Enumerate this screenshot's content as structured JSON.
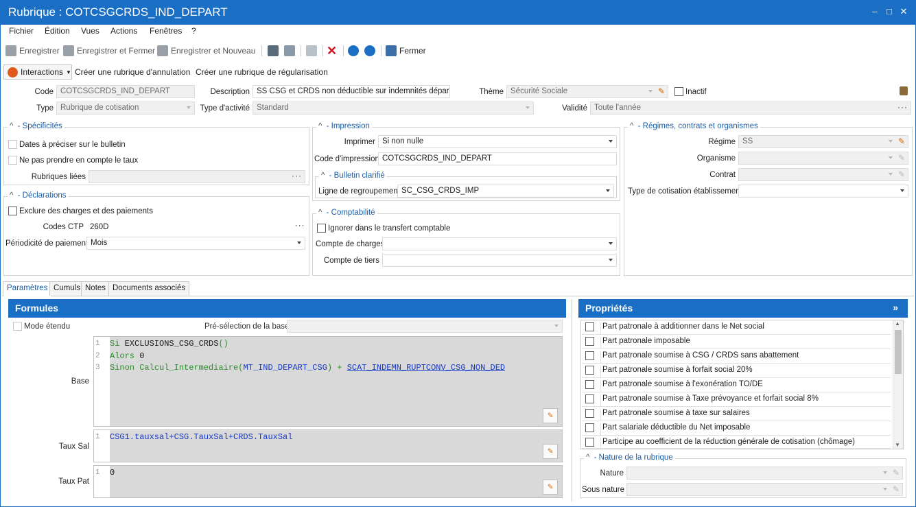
{
  "window": {
    "title": "Rubrique : COTCSGCRDS_IND_DEPART",
    "minimize": "–",
    "maximize": "□",
    "close": "✕"
  },
  "menu": [
    "Fichier",
    "Édition",
    "Vues",
    "Actions",
    "Fenêtres",
    "?"
  ],
  "toolbar": {
    "save": "Enregistrer",
    "save_close": "Enregistrer et Fermer",
    "save_new": "Enregistrer et Nouveau",
    "close": "Fermer"
  },
  "actions": {
    "interactions": "Interactions",
    "cancel_rubrique": "Créer une rubrique d'annulation",
    "regul_rubrique": "Créer une rubrique de régularisation"
  },
  "header": {
    "code_label": "Code",
    "code": "COTCSGCRDS_IND_DEPART",
    "description_label": "Description",
    "description": "SS CSG et CRDS non déductible sur indemnités départ",
    "theme_label": "Thème",
    "theme": "Sécurité Sociale",
    "inactive_label": "Inactif",
    "type_label": "Type",
    "type": "Rubrique de cotisation",
    "activity_label": "Type d'activité",
    "activity": "Standard",
    "validity_label": "Validité",
    "validity": "Toute l'année"
  },
  "specificites": {
    "title": "Spécificités",
    "dates": "Dates à préciser sur le bulletin",
    "taux": "Ne pas prendre en compte le taux",
    "liees_label": "Rubriques liées",
    "liees": ""
  },
  "declarations": {
    "title": "Déclarations",
    "exclure": "Exclure des charges et des paiements",
    "ctp_label": "Codes CTP",
    "ctp": "260D",
    "periodicite_label": "Périodicité de paiement",
    "periodicite": "Mois"
  },
  "impression": {
    "title": "Impression",
    "imprimer_label": "Imprimer",
    "imprimer": "Si non nulle",
    "code_label": "Code d'impression",
    "code": "COTCSGCRDS_IND_DEPART"
  },
  "bulletin": {
    "title": "Bulletin clarifié",
    "ligne_label": "Ligne de regroupement",
    "ligne": "SC_CSG_CRDS_IMP"
  },
  "comptabilite": {
    "title": "Comptabilité",
    "ignorer": "Ignorer dans le transfert comptable",
    "charges_label": "Compte de charges",
    "tiers_label": "Compte de tiers"
  },
  "regimes": {
    "title": "Régimes, contrats et organismes",
    "regime_label": "Régime",
    "regime": "SS",
    "organisme_label": "Organisme",
    "contrat_label": "Contrat",
    "type_label": "Type de cotisation établissement"
  },
  "tabs": [
    "Paramètres",
    "Cumuls",
    "Notes",
    "Documents associés"
  ],
  "formules": {
    "title": "Formules",
    "mode": "Mode étendu",
    "preselection": "Pré-sélection de la base",
    "base_label": "Base",
    "sal_label": "Taux Sal",
    "pat_label": "Taux Pat",
    "base_l1_kw": "Si",
    "base_l1_fn": "EXCLUSIONS_CSG_CRDS",
    "base_l1_p": "()",
    "base_l2_kw": "Alors",
    "base_l2_v": "0",
    "base_l3_kw": "Sinon",
    "base_l3_fn": "Calcul_Intermediaire",
    "base_l3_arg": "MT_IND_DEPART_CSG",
    "base_l3_op": "+",
    "base_l3_link": "SCAT_INDEMN_RUPTCONV_CSG_NON_DED",
    "sal": "CSG1.tauxsal+CSG.TauxSal+CRDS.TauxSal",
    "pat": "0",
    "ln1": "1",
    "ln2": "2",
    "ln3": "3"
  },
  "proprietes": {
    "title": "Propriétés",
    "collapse": "»",
    "items": [
      "Part patronale à additionner dans le Net social",
      "Part patronale imposable",
      "Part patronale soumise à CSG / CRDS sans abattement",
      "Part patronale soumise à forfait social 20%",
      "Part patronale soumise à l'exonération TO/DE",
      "Part patronale soumise à Taxe prévoyance et forfait social 8%",
      "Part patronale soumise à taxe sur salaires",
      "Part salariale déductible du Net imposable",
      "Participe au coefficient de la réduction générale de cotisation (chômage)"
    ]
  },
  "nature": {
    "title": "Nature de la rubrique",
    "nature_label": "Nature",
    "sous_label": "Sous nature"
  },
  "colors": {
    "accent": "#1a6fc4",
    "group_title": "#1a5ea8"
  }
}
